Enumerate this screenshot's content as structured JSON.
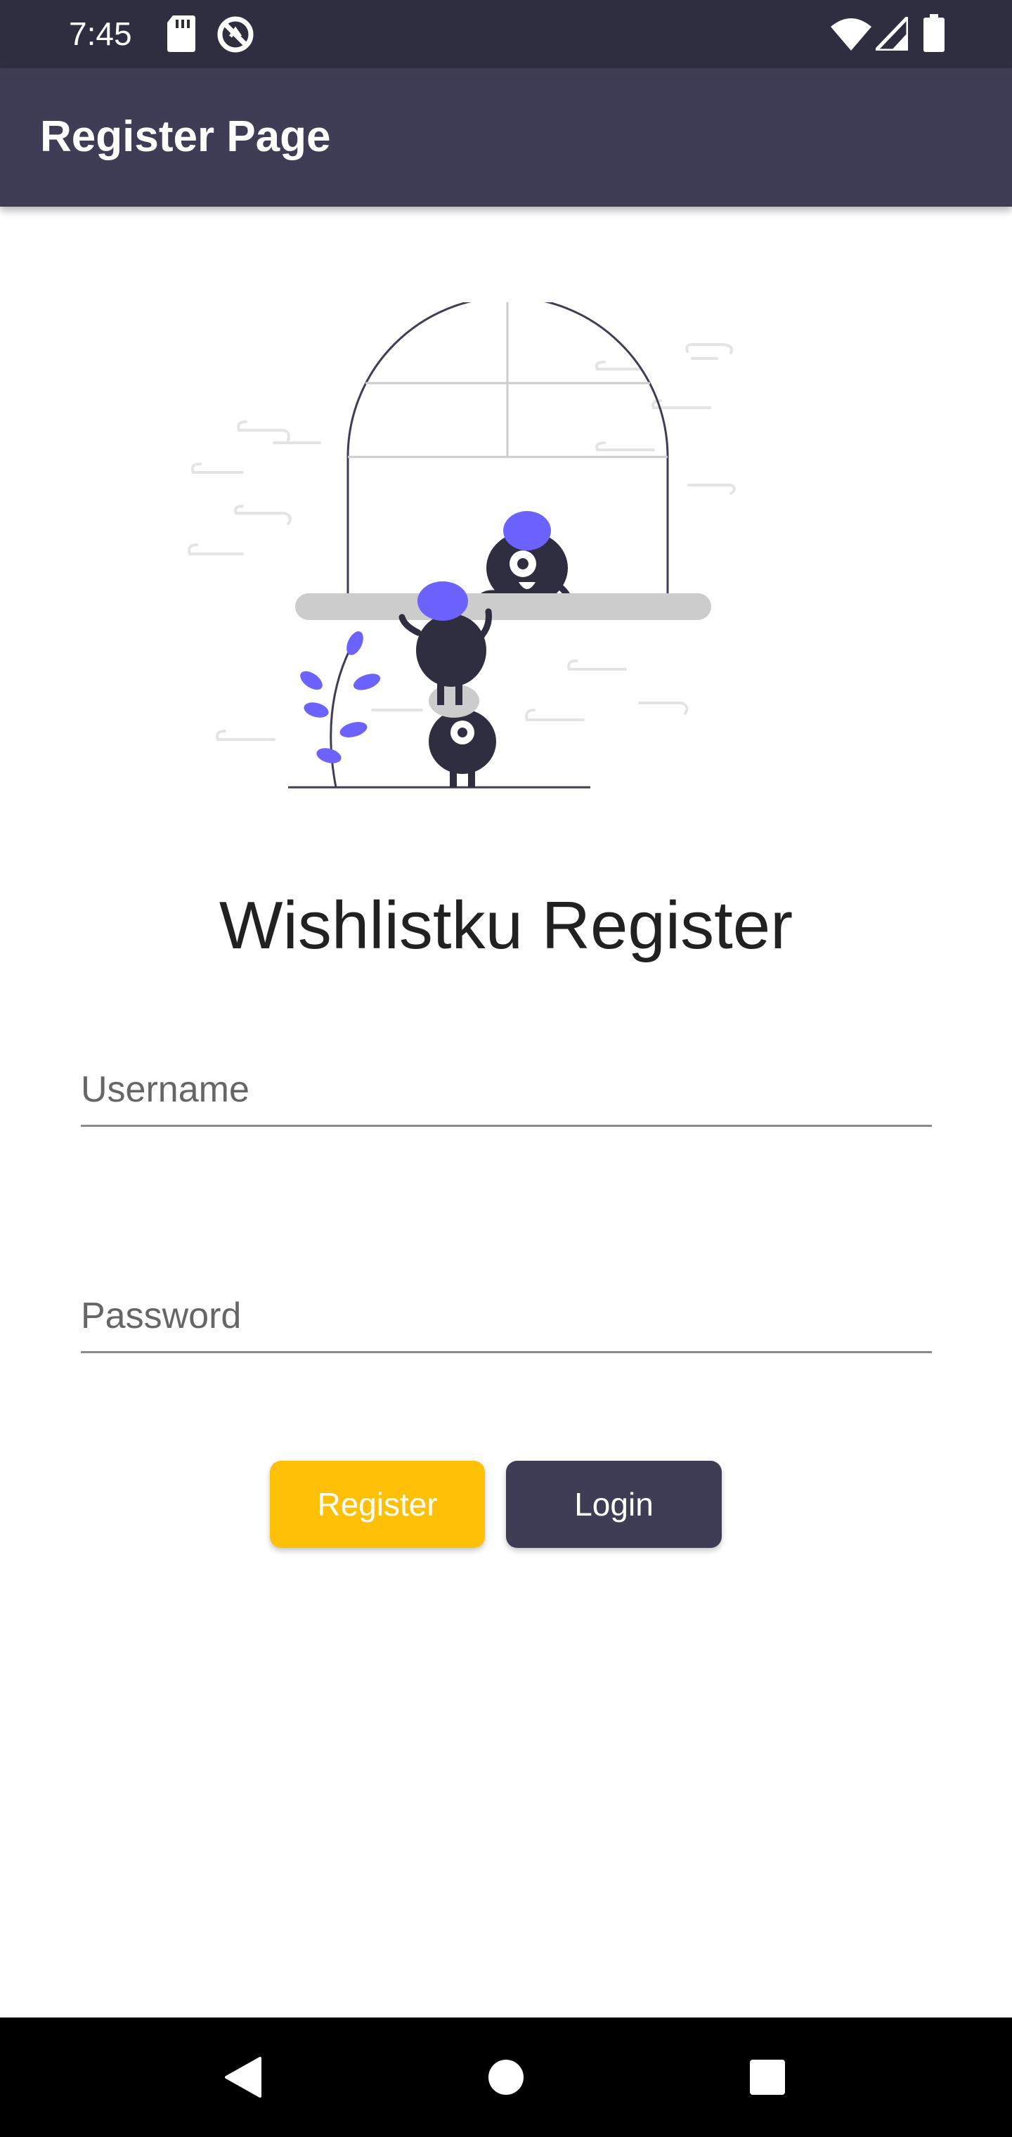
{
  "status_bar": {
    "time": "7:45",
    "icons": [
      "sd-card-icon",
      "no-sync-icon",
      "wifi-icon",
      "signal-icon",
      "battery-icon"
    ]
  },
  "app_bar": {
    "title": "Register Page"
  },
  "main": {
    "heading": "Wishlistku Register",
    "username_placeholder": "Username",
    "username_value": "",
    "password_placeholder": "Password",
    "password_value": "",
    "register_label": "Register",
    "login_label": "Login"
  },
  "colors": {
    "status_bar": "#2f2e41",
    "app_bar": "#3f3d56",
    "register_button": "#ffc107",
    "login_button": "#3f3d56",
    "accent": "#6c63ff"
  },
  "nav_bar": {
    "icons": [
      "back-icon",
      "home-icon",
      "recents-icon"
    ]
  }
}
